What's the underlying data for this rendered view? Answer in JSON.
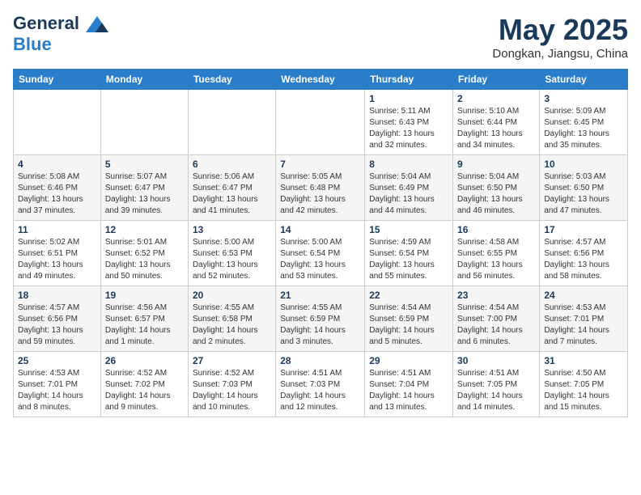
{
  "header": {
    "logo_line1": "General",
    "logo_line2": "Blue",
    "month_title": "May 2025",
    "location": "Dongkan, Jiangsu, China"
  },
  "days_of_week": [
    "Sunday",
    "Monday",
    "Tuesday",
    "Wednesday",
    "Thursday",
    "Friday",
    "Saturday"
  ],
  "weeks": [
    [
      {
        "day": "",
        "info": ""
      },
      {
        "day": "",
        "info": ""
      },
      {
        "day": "",
        "info": ""
      },
      {
        "day": "",
        "info": ""
      },
      {
        "day": "1",
        "info": "Sunrise: 5:11 AM\nSunset: 6:43 PM\nDaylight: 13 hours\nand 32 minutes."
      },
      {
        "day": "2",
        "info": "Sunrise: 5:10 AM\nSunset: 6:44 PM\nDaylight: 13 hours\nand 34 minutes."
      },
      {
        "day": "3",
        "info": "Sunrise: 5:09 AM\nSunset: 6:45 PM\nDaylight: 13 hours\nand 35 minutes."
      }
    ],
    [
      {
        "day": "4",
        "info": "Sunrise: 5:08 AM\nSunset: 6:46 PM\nDaylight: 13 hours\nand 37 minutes."
      },
      {
        "day": "5",
        "info": "Sunrise: 5:07 AM\nSunset: 6:47 PM\nDaylight: 13 hours\nand 39 minutes."
      },
      {
        "day": "6",
        "info": "Sunrise: 5:06 AM\nSunset: 6:47 PM\nDaylight: 13 hours\nand 41 minutes."
      },
      {
        "day": "7",
        "info": "Sunrise: 5:05 AM\nSunset: 6:48 PM\nDaylight: 13 hours\nand 42 minutes."
      },
      {
        "day": "8",
        "info": "Sunrise: 5:04 AM\nSunset: 6:49 PM\nDaylight: 13 hours\nand 44 minutes."
      },
      {
        "day": "9",
        "info": "Sunrise: 5:04 AM\nSunset: 6:50 PM\nDaylight: 13 hours\nand 46 minutes."
      },
      {
        "day": "10",
        "info": "Sunrise: 5:03 AM\nSunset: 6:50 PM\nDaylight: 13 hours\nand 47 minutes."
      }
    ],
    [
      {
        "day": "11",
        "info": "Sunrise: 5:02 AM\nSunset: 6:51 PM\nDaylight: 13 hours\nand 49 minutes."
      },
      {
        "day": "12",
        "info": "Sunrise: 5:01 AM\nSunset: 6:52 PM\nDaylight: 13 hours\nand 50 minutes."
      },
      {
        "day": "13",
        "info": "Sunrise: 5:00 AM\nSunset: 6:53 PM\nDaylight: 13 hours\nand 52 minutes."
      },
      {
        "day": "14",
        "info": "Sunrise: 5:00 AM\nSunset: 6:54 PM\nDaylight: 13 hours\nand 53 minutes."
      },
      {
        "day": "15",
        "info": "Sunrise: 4:59 AM\nSunset: 6:54 PM\nDaylight: 13 hours\nand 55 minutes."
      },
      {
        "day": "16",
        "info": "Sunrise: 4:58 AM\nSunset: 6:55 PM\nDaylight: 13 hours\nand 56 minutes."
      },
      {
        "day": "17",
        "info": "Sunrise: 4:57 AM\nSunset: 6:56 PM\nDaylight: 13 hours\nand 58 minutes."
      }
    ],
    [
      {
        "day": "18",
        "info": "Sunrise: 4:57 AM\nSunset: 6:56 PM\nDaylight: 13 hours\nand 59 minutes."
      },
      {
        "day": "19",
        "info": "Sunrise: 4:56 AM\nSunset: 6:57 PM\nDaylight: 14 hours\nand 1 minute."
      },
      {
        "day": "20",
        "info": "Sunrise: 4:55 AM\nSunset: 6:58 PM\nDaylight: 14 hours\nand 2 minutes."
      },
      {
        "day": "21",
        "info": "Sunrise: 4:55 AM\nSunset: 6:59 PM\nDaylight: 14 hours\nand 3 minutes."
      },
      {
        "day": "22",
        "info": "Sunrise: 4:54 AM\nSunset: 6:59 PM\nDaylight: 14 hours\nand 5 minutes."
      },
      {
        "day": "23",
        "info": "Sunrise: 4:54 AM\nSunset: 7:00 PM\nDaylight: 14 hours\nand 6 minutes."
      },
      {
        "day": "24",
        "info": "Sunrise: 4:53 AM\nSunset: 7:01 PM\nDaylight: 14 hours\nand 7 minutes."
      }
    ],
    [
      {
        "day": "25",
        "info": "Sunrise: 4:53 AM\nSunset: 7:01 PM\nDaylight: 14 hours\nand 8 minutes."
      },
      {
        "day": "26",
        "info": "Sunrise: 4:52 AM\nSunset: 7:02 PM\nDaylight: 14 hours\nand 9 minutes."
      },
      {
        "day": "27",
        "info": "Sunrise: 4:52 AM\nSunset: 7:03 PM\nDaylight: 14 hours\nand 10 minutes."
      },
      {
        "day": "28",
        "info": "Sunrise: 4:51 AM\nSunset: 7:03 PM\nDaylight: 14 hours\nand 12 minutes."
      },
      {
        "day": "29",
        "info": "Sunrise: 4:51 AM\nSunset: 7:04 PM\nDaylight: 14 hours\nand 13 minutes."
      },
      {
        "day": "30",
        "info": "Sunrise: 4:51 AM\nSunset: 7:05 PM\nDaylight: 14 hours\nand 14 minutes."
      },
      {
        "day": "31",
        "info": "Sunrise: 4:50 AM\nSunset: 7:05 PM\nDaylight: 14 hours\nand 15 minutes."
      }
    ]
  ]
}
